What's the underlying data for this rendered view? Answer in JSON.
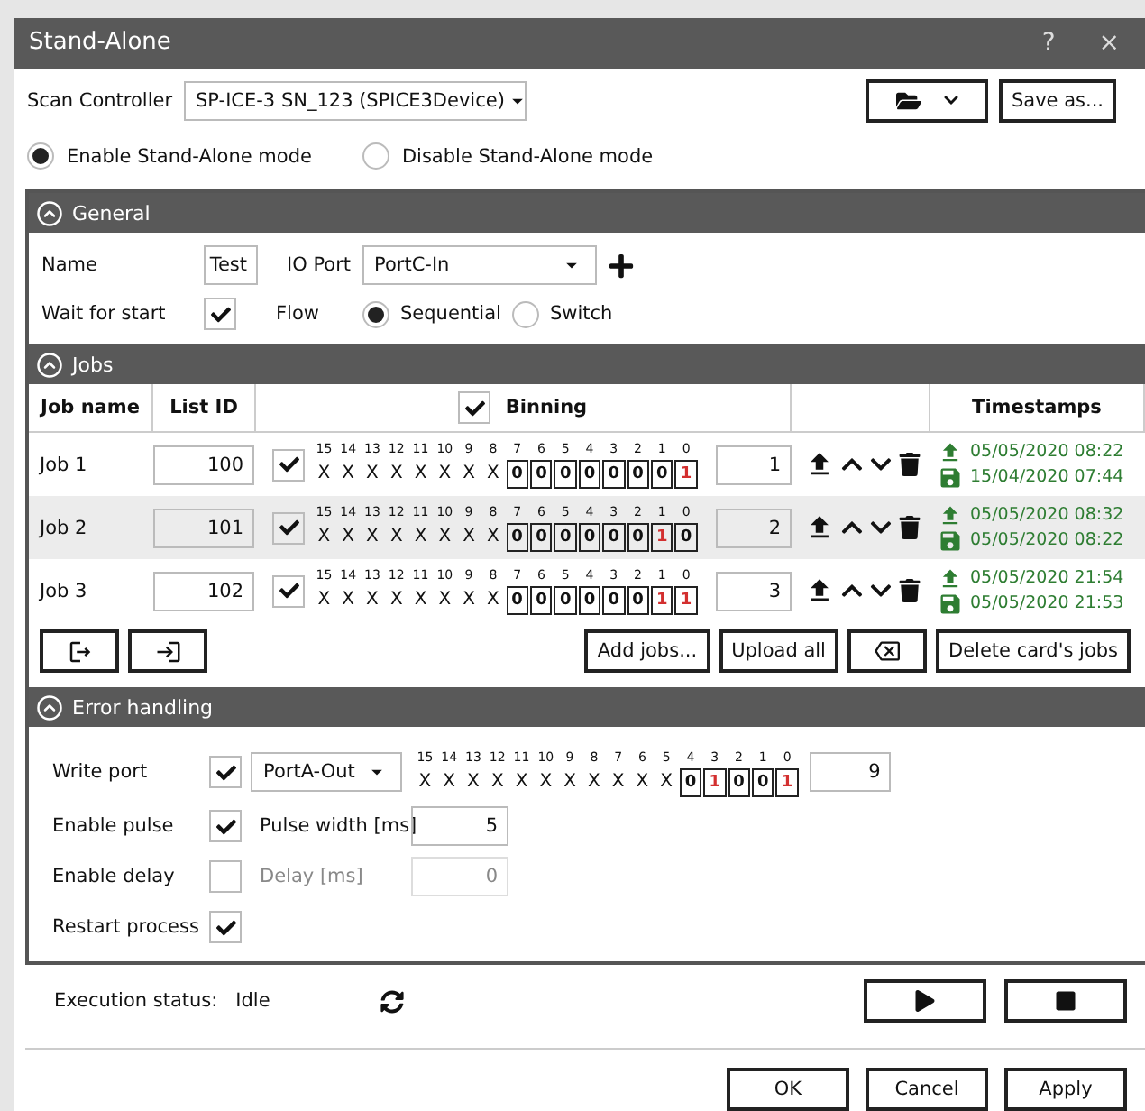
{
  "window": {
    "title": "Stand-Alone",
    "help": "?",
    "close": "×"
  },
  "scan_controller": {
    "label": "Scan Controller",
    "value": "SP-ICE-3 SN_123 (SPICE3Device)"
  },
  "save_as": "Save as...",
  "modes": [
    {
      "label": "Enable Stand-Alone mode",
      "selected": true
    },
    {
      "label": "Disable Stand-Alone mode",
      "selected": false
    }
  ],
  "general": {
    "title": "General",
    "name_label": "Name",
    "name_value": "Test",
    "io_port_label": "IO Port",
    "io_port_value": "PortC-In",
    "wait_label": "Wait for start",
    "wait_checked": true,
    "flow_label": "Flow",
    "flow_options": [
      {
        "label": "Sequential",
        "selected": true
      },
      {
        "label": "Switch",
        "selected": false
      }
    ]
  },
  "jobs": {
    "title": "Jobs",
    "columns": [
      "Job name",
      "List ID",
      "Binning",
      "Timestamps"
    ],
    "binning_checked": true,
    "rows": [
      {
        "name": "Job 1",
        "list_id": "100",
        "checked": true,
        "value": "1",
        "uploaded": "05/05/2020 08:22",
        "saved": "15/04/2020 07:44",
        "selected": false,
        "bits": [
          {
            "label": "15",
            "kind": "masked",
            "value": "X"
          },
          {
            "label": "14",
            "kind": "masked",
            "value": "X"
          },
          {
            "label": "13",
            "kind": "masked",
            "value": "X"
          },
          {
            "label": "12",
            "kind": "masked",
            "value": "X"
          },
          {
            "label": "11",
            "kind": "masked",
            "value": "X"
          },
          {
            "label": "10",
            "kind": "masked",
            "value": "X"
          },
          {
            "label": "9",
            "kind": "masked",
            "value": "X"
          },
          {
            "label": "8",
            "kind": "masked",
            "value": "X"
          },
          {
            "label": "7",
            "kind": "bit",
            "value": "0",
            "set": false
          },
          {
            "label": "6",
            "kind": "bit",
            "value": "0",
            "set": false
          },
          {
            "label": "5",
            "kind": "bit",
            "value": "0",
            "set": false
          },
          {
            "label": "4",
            "kind": "bit",
            "value": "0",
            "set": false
          },
          {
            "label": "3",
            "kind": "bit",
            "value": "0",
            "set": false
          },
          {
            "label": "2",
            "kind": "bit",
            "value": "0",
            "set": false
          },
          {
            "label": "1",
            "kind": "bit",
            "value": "0",
            "set": false
          },
          {
            "label": "0",
            "kind": "bit",
            "value": "1",
            "set": true
          }
        ]
      },
      {
        "name": "Job 2",
        "list_id": "101",
        "checked": true,
        "value": "2",
        "uploaded": "05/05/2020 08:32",
        "saved": "05/05/2020 08:22",
        "selected": true,
        "bits": [
          {
            "label": "15",
            "kind": "masked",
            "value": "X"
          },
          {
            "label": "14",
            "kind": "masked",
            "value": "X"
          },
          {
            "label": "13",
            "kind": "masked",
            "value": "X"
          },
          {
            "label": "12",
            "kind": "masked",
            "value": "X"
          },
          {
            "label": "11",
            "kind": "masked",
            "value": "X"
          },
          {
            "label": "10",
            "kind": "masked",
            "value": "X"
          },
          {
            "label": "9",
            "kind": "masked",
            "value": "X"
          },
          {
            "label": "8",
            "kind": "masked",
            "value": "X"
          },
          {
            "label": "7",
            "kind": "bit",
            "value": "0",
            "set": false
          },
          {
            "label": "6",
            "kind": "bit",
            "value": "0",
            "set": false
          },
          {
            "label": "5",
            "kind": "bit",
            "value": "0",
            "set": false
          },
          {
            "label": "4",
            "kind": "bit",
            "value": "0",
            "set": false
          },
          {
            "label": "3",
            "kind": "bit",
            "value": "0",
            "set": false
          },
          {
            "label": "2",
            "kind": "bit",
            "value": "0",
            "set": false
          },
          {
            "label": "1",
            "kind": "bit",
            "value": "1",
            "set": true
          },
          {
            "label": "0",
            "kind": "bit",
            "value": "0",
            "set": false
          }
        ]
      },
      {
        "name": "Job 3",
        "list_id": "102",
        "checked": true,
        "value": "3",
        "uploaded": "05/05/2020 21:54",
        "saved": "05/05/2020 21:53",
        "selected": false,
        "bits": [
          {
            "label": "15",
            "kind": "masked",
            "value": "X"
          },
          {
            "label": "14",
            "kind": "masked",
            "value": "X"
          },
          {
            "label": "13",
            "kind": "masked",
            "value": "X"
          },
          {
            "label": "12",
            "kind": "masked",
            "value": "X"
          },
          {
            "label": "11",
            "kind": "masked",
            "value": "X"
          },
          {
            "label": "10",
            "kind": "masked",
            "value": "X"
          },
          {
            "label": "9",
            "kind": "masked",
            "value": "X"
          },
          {
            "label": "8",
            "kind": "masked",
            "value": "X"
          },
          {
            "label": "7",
            "kind": "bit",
            "value": "0",
            "set": false
          },
          {
            "label": "6",
            "kind": "bit",
            "value": "0",
            "set": false
          },
          {
            "label": "5",
            "kind": "bit",
            "value": "0",
            "set": false
          },
          {
            "label": "4",
            "kind": "bit",
            "value": "0",
            "set": false
          },
          {
            "label": "3",
            "kind": "bit",
            "value": "0",
            "set": false
          },
          {
            "label": "2",
            "kind": "bit",
            "value": "0",
            "set": false
          },
          {
            "label": "1",
            "kind": "bit",
            "value": "1",
            "set": true
          },
          {
            "label": "0",
            "kind": "bit",
            "value": "1",
            "set": true
          }
        ]
      }
    ],
    "buttons": [
      "Add jobs...",
      "Upload all",
      "Delete card's jobs"
    ]
  },
  "error_handling": {
    "title": "Error handling",
    "write_port": {
      "label": "Write port",
      "checked": true,
      "port": "PortA-Out",
      "value": "9",
      "bits": [
        {
          "label": "15",
          "kind": "masked",
          "value": "X"
        },
        {
          "label": "14",
          "kind": "masked",
          "value": "X"
        },
        {
          "label": "13",
          "kind": "masked",
          "value": "X"
        },
        {
          "label": "12",
          "kind": "masked",
          "value": "X"
        },
        {
          "label": "11",
          "kind": "masked",
          "value": "X"
        },
        {
          "label": "10",
          "kind": "masked",
          "value": "X"
        },
        {
          "label": "9",
          "kind": "masked",
          "value": "X"
        },
        {
          "label": "8",
          "kind": "masked",
          "value": "X"
        },
        {
          "label": "7",
          "kind": "masked",
          "value": "X"
        },
        {
          "label": "6",
          "kind": "masked",
          "value": "X"
        },
        {
          "label": "5",
          "kind": "masked",
          "value": "X"
        },
        {
          "label": "4",
          "kind": "bit",
          "value": "0",
          "set": false
        },
        {
          "label": "3",
          "kind": "bit",
          "value": "1",
          "set": true
        },
        {
          "label": "2",
          "kind": "bit",
          "value": "0",
          "set": false
        },
        {
          "label": "1",
          "kind": "bit",
          "value": "0",
          "set": false
        },
        {
          "label": "0",
          "kind": "bit",
          "value": "1",
          "set": true
        }
      ]
    },
    "pulse": {
      "label": "Enable pulse",
      "checked": true,
      "field_label": "Pulse width [ms]",
      "value": "5",
      "disabled": false
    },
    "delay": {
      "label": "Enable delay",
      "checked": false,
      "field_label": "Delay [ms]",
      "value": "0",
      "disabled": true
    },
    "restart": {
      "label": "Restart process",
      "checked": true
    }
  },
  "execution": {
    "label": "Execution status:",
    "status": "Idle"
  },
  "footer_buttons": [
    "OK",
    "Cancel",
    "Apply"
  ]
}
